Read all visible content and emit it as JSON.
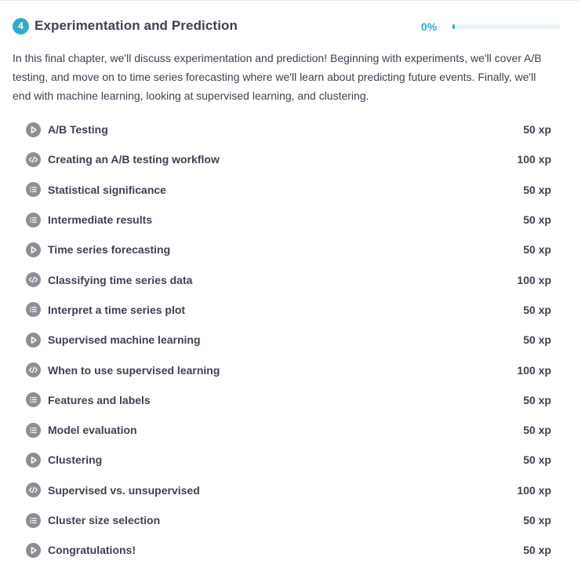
{
  "chapter": {
    "number": "4",
    "title": "Experimentation and Prediction",
    "progress_label": "0%",
    "progress_fraction": 0.0,
    "description": "In this final chapter, we'll discuss experimentation and prediction! Beginning with experiments, we'll cover A/B testing, and move on to time series forecasting where we'll learn about predicting future events. Finally, we'll end with machine learning, looking at supervised learning, and clustering."
  },
  "colors": {
    "accent": "#33aacc",
    "icon_bg": "#8c8f95",
    "text": "#3d4251"
  },
  "exercises": [
    {
      "title": "A/B Testing",
      "xp": "50 xp",
      "icon": "play-icon"
    },
    {
      "title": "Creating an A/B testing workflow",
      "xp": "100 xp",
      "icon": "code-icon"
    },
    {
      "title": "Statistical significance",
      "xp": "50 xp",
      "icon": "list-icon"
    },
    {
      "title": "Intermediate results",
      "xp": "50 xp",
      "icon": "list-icon"
    },
    {
      "title": "Time series forecasting",
      "xp": "50 xp",
      "icon": "play-icon"
    },
    {
      "title": "Classifying time series data",
      "xp": "100 xp",
      "icon": "code-icon"
    },
    {
      "title": "Interpret a time series plot",
      "xp": "50 xp",
      "icon": "list-icon"
    },
    {
      "title": "Supervised machine learning",
      "xp": "50 xp",
      "icon": "play-icon"
    },
    {
      "title": "When to use supervised learning",
      "xp": "100 xp",
      "icon": "code-icon"
    },
    {
      "title": "Features and labels",
      "xp": "50 xp",
      "icon": "list-icon"
    },
    {
      "title": "Model evaluation",
      "xp": "50 xp",
      "icon": "list-icon"
    },
    {
      "title": "Clustering",
      "xp": "50 xp",
      "icon": "play-icon"
    },
    {
      "title": "Supervised vs. unsupervised",
      "xp": "100 xp",
      "icon": "code-icon"
    },
    {
      "title": "Cluster size selection",
      "xp": "50 xp",
      "icon": "list-icon"
    },
    {
      "title": "Congratulations!",
      "xp": "50 xp",
      "icon": "play-icon"
    }
  ]
}
